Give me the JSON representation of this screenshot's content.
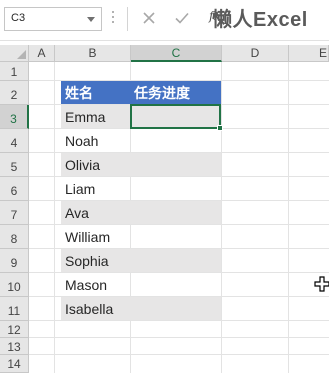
{
  "formula_bar": {
    "name_box": "C3",
    "cancel_icon": "x-icon",
    "enter_icon": "check-icon",
    "fx_label": "fx",
    "formula_value": "",
    "watermark": "懒人Excel"
  },
  "columns": [
    "A",
    "B",
    "C",
    "D",
    "E"
  ],
  "rows": [
    "1",
    "2",
    "3",
    "4",
    "5",
    "6",
    "7",
    "8",
    "9",
    "10",
    "11",
    "12",
    "13",
    "14"
  ],
  "table": {
    "header_name": "姓名",
    "header_progress": "任务进度",
    "names": [
      "Emma",
      "Noah",
      "Olivia",
      "Liam",
      "Ava",
      "William",
      "Sophia",
      "Mason",
      "Isabella"
    ]
  },
  "selection": {
    "active_cell": "C3"
  },
  "colors": {
    "header_fill": "#4472c4",
    "band_fill": "#e7e6e6",
    "selection_accent": "#217346"
  }
}
